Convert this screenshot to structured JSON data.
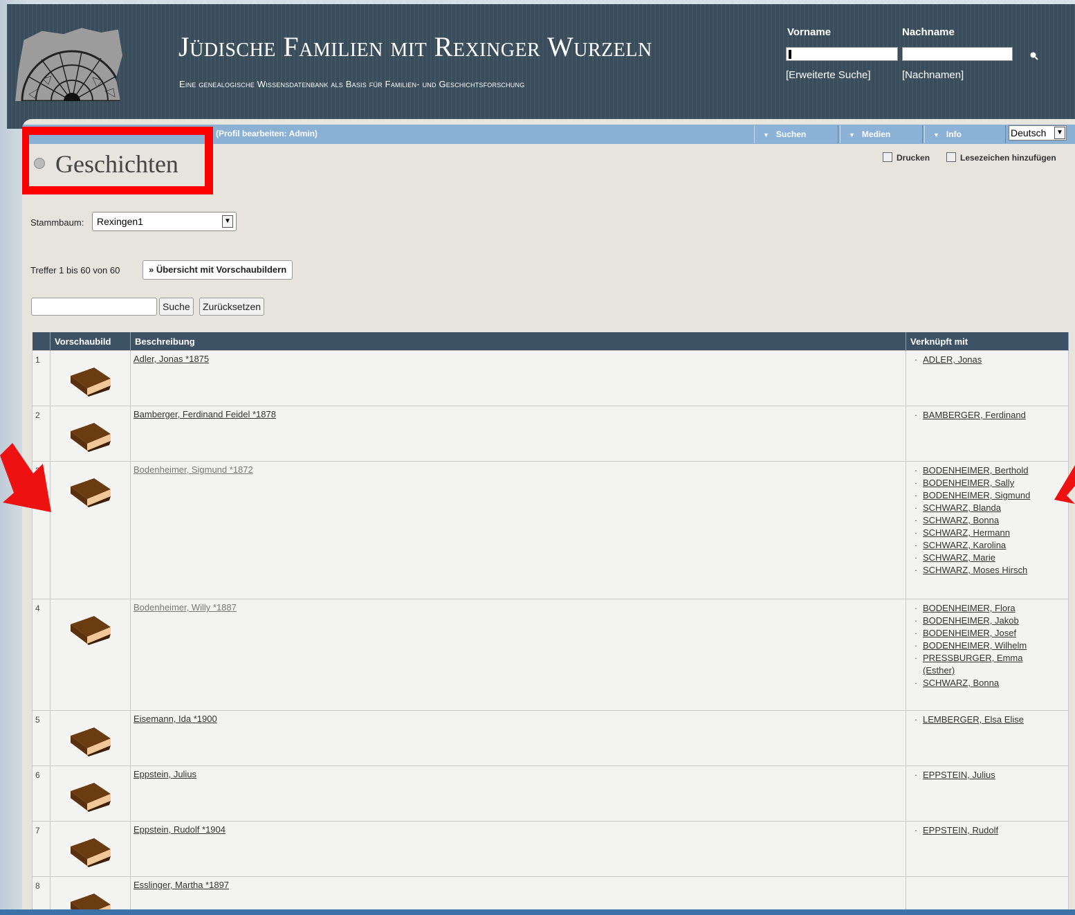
{
  "header": {
    "title": "Jüdische Familien mit Rexinger Wurzeln",
    "subtitle": "Eine genealogische Wissensdatenbank als Basis für Familien- und Geschichtsforschung",
    "firstname_label": "Vorname",
    "lastname_label": "Nachname",
    "advanced_search": "[Erweiterte Suche]",
    "surnames_link": "[Nachnamen]"
  },
  "menubar": {
    "left_text": "(Profil bearbeiten: Admin)",
    "items": [
      "Suchen",
      "Medien",
      "Info"
    ],
    "language": "Deutsch"
  },
  "page": {
    "title": "Geschichten",
    "print": "Drucken",
    "bookmark": "Lesezeichen hinzufügen",
    "tree_label": "Stammbaum:",
    "tree_value": "Rexingen1",
    "hits": "Treffer 1 bis 60 von 60",
    "thumb_overview": "» Übersicht mit Vorschaubildern",
    "search_btn": "Suche",
    "reset_btn": "Zurücksetzen"
  },
  "table": {
    "headers": [
      "",
      "Vorschaubild",
      "Beschreibung",
      "Verknüpft mit"
    ],
    "rows": [
      {
        "num": "1",
        "desc": "Adler, Jonas *1875",
        "links": [
          "ADLER, Jonas"
        ]
      },
      {
        "num": "2",
        "desc": "Bamberger, Ferdinand Feidel *1878",
        "links": [
          "BAMBERGER, Ferdinand"
        ]
      },
      {
        "num": "3",
        "desc": "Bodenheimer, Sigmund *1872",
        "links": [
          "BODENHEIMER, Berthold",
          "BODENHEIMER, Sally",
          "BODENHEIMER, Sigmund",
          "SCHWARZ, Blanda",
          "SCHWARZ, Bonna",
          "SCHWARZ, Hermann",
          "SCHWARZ, Karolina",
          "SCHWARZ, Marie",
          "SCHWARZ, Moses Hirsch"
        ]
      },
      {
        "num": "4",
        "desc": "Bodenheimer, Willy *1887",
        "links": [
          "BODENHEIMER, Flora",
          "BODENHEIMER, Jakob",
          "BODENHEIMER, Josef",
          "BODENHEIMER, Wilhelm",
          "PRESSBURGER, Emma (Esther)",
          "SCHWARZ, Bonna"
        ]
      },
      {
        "num": "5",
        "desc": "Eisemann, Ida *1900",
        "links": [
          "LEMBERGER, Elsa Elise"
        ]
      },
      {
        "num": "6",
        "desc": "Eppstein, Julius",
        "links": [
          "EPPSTEIN, Julius"
        ]
      },
      {
        "num": "7",
        "desc": "Eppstein, Rudolf *1904",
        "links": [
          "EPPSTEIN, Rudolf"
        ]
      },
      {
        "num": "8",
        "desc": "Esslinger, Martha *1897",
        "links": []
      }
    ]
  },
  "colors": {
    "header_bg": "#3b4f5e",
    "menubar": "#8ab0d3",
    "table_header": "#3d5265",
    "highlight": "#ff0000"
  }
}
